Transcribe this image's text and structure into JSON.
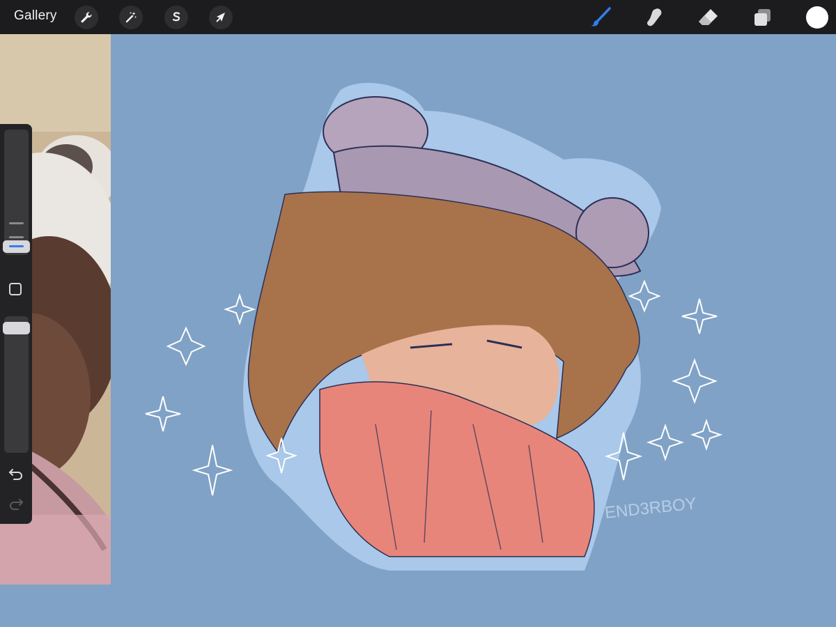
{
  "topbar": {
    "gallery_label": "Gallery",
    "left_tools": [
      {
        "name": "actions",
        "icon": "wrench-icon"
      },
      {
        "name": "adjustments",
        "icon": "magic-wand-icon"
      },
      {
        "name": "selection",
        "icon": "selection-s-icon"
      },
      {
        "name": "transform",
        "icon": "arrow-cursor-icon"
      }
    ],
    "right_tools": [
      {
        "name": "brush",
        "icon": "brush-icon",
        "active": true
      },
      {
        "name": "smudge",
        "icon": "smudge-icon"
      },
      {
        "name": "eraser",
        "icon": "eraser-icon"
      },
      {
        "name": "layers",
        "icon": "layers-icon"
      }
    ],
    "current_color": "#ffffff",
    "active_color": "#2f7fea"
  },
  "sidebar": {
    "brush_size_level": 0.3,
    "opacity_level": 0.72,
    "controls": [
      "brush-size-slider",
      "modify-button",
      "opacity-slider",
      "undo-button",
      "redo-button"
    ]
  },
  "canvas": {
    "background_color": "#80a2c6",
    "signature_text": "END3RBOY"
  }
}
